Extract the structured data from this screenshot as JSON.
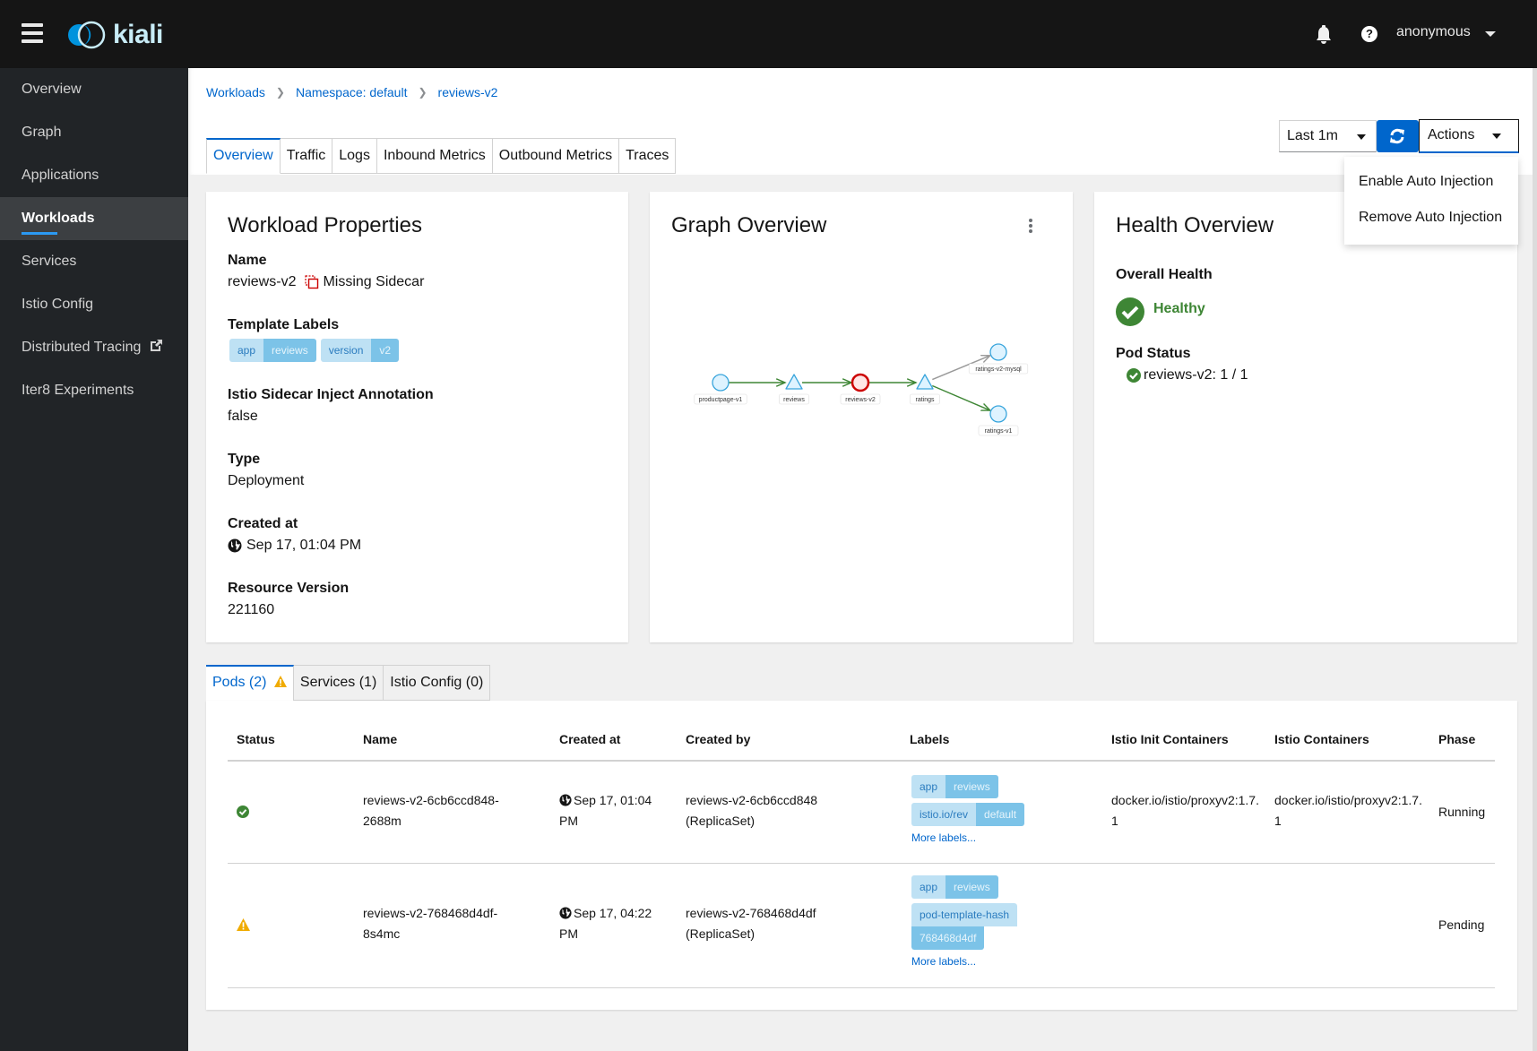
{
  "app": {
    "name": "kiali",
    "logo_icon": "kiali-logo"
  },
  "topbar": {
    "menu_icon": "hamburger-icon",
    "notifications_icon": "bell-icon",
    "help_icon": "question-circle-icon",
    "help_glyph": "?",
    "user": "anonymous"
  },
  "sidebar": {
    "items": [
      {
        "label": "Overview"
      },
      {
        "label": "Graph"
      },
      {
        "label": "Applications"
      },
      {
        "label": "Workloads",
        "active": true
      },
      {
        "label": "Services"
      },
      {
        "label": "Istio Config"
      },
      {
        "label": "Distributed Tracing",
        "icon": "external-link-icon"
      },
      {
        "label": "Iter8 Experiments"
      }
    ]
  },
  "breadcrumb": [
    "Workloads",
    "Namespace: default",
    "reviews-v2"
  ],
  "tabs": [
    {
      "label": "Overview",
      "active": true
    },
    {
      "label": "Traffic"
    },
    {
      "label": "Logs"
    },
    {
      "label": "Inbound Metrics"
    },
    {
      "label": "Outbound Metrics"
    },
    {
      "label": "Traces"
    }
  ],
  "toolbar": {
    "time_range": "Last 1m",
    "refresh_icon": "sync-icon",
    "actions_label": "Actions",
    "actions_menu": [
      "Enable Auto Injection",
      "Remove Auto Injection"
    ]
  },
  "workload_properties": {
    "title": "Workload Properties",
    "name_label": "Name",
    "name": "reviews-v2",
    "missing_sidecar": "Missing Sidecar",
    "template_labels_label": "Template Labels",
    "template_labels": [
      {
        "key": "app",
        "value": "reviews"
      },
      {
        "key": "version",
        "value": "v2"
      }
    ],
    "inject_annotation_label": "Istio Sidecar Inject Annotation",
    "inject_annotation": "false",
    "type_label": "Type",
    "type": "Deployment",
    "created_label": "Created at",
    "created": "Sep 17, 01:04 PM",
    "resource_version_label": "Resource Version",
    "resource_version": "221160"
  },
  "graph_overview": {
    "title": "Graph Overview",
    "nodes": [
      {
        "id": "productpage-v1",
        "shape": "circle",
        "status": "normal"
      },
      {
        "id": "reviews",
        "shape": "triangle",
        "status": "normal"
      },
      {
        "id": "reviews-v2",
        "shape": "circle",
        "status": "error"
      },
      {
        "id": "ratings",
        "shape": "triangle",
        "status": "normal"
      },
      {
        "id": "ratings-v2-mysql",
        "shape": "circle",
        "status": "normal"
      },
      {
        "id": "ratings-v1",
        "shape": "circle",
        "status": "normal"
      }
    ],
    "edges": [
      {
        "from": "productpage-v1",
        "to": "reviews",
        "status": "healthy"
      },
      {
        "from": "reviews",
        "to": "reviews-v2",
        "status": "healthy"
      },
      {
        "from": "reviews-v2",
        "to": "ratings",
        "status": "healthy"
      },
      {
        "from": "ratings",
        "to": "ratings-v2-mysql",
        "status": "idle"
      },
      {
        "from": "ratings",
        "to": "ratings-v1",
        "status": "healthy"
      }
    ],
    "colors": {
      "healthy": "#3e8635",
      "idle": "#999999",
      "node_fill": "#def3ff",
      "node_stroke": "#39a5dc",
      "error_fill": "#ffe6e6",
      "error_stroke": "#cc0000"
    }
  },
  "health_overview": {
    "title": "Health Overview",
    "overall_label": "Overall Health",
    "overall": "Healthy",
    "pod_status_label": "Pod Status",
    "pod_status": "reviews-v2: 1 / 1"
  },
  "bottom_tabs": [
    {
      "label": "Pods (2)",
      "active": true,
      "warning": true
    },
    {
      "label": "Services (1)"
    },
    {
      "label": "Istio Config (0)"
    }
  ],
  "pods_table": {
    "columns": [
      "Status",
      "Name",
      "Created at",
      "Created by",
      "Labels",
      "Istio Init Containers",
      "Istio Containers",
      "Phase"
    ],
    "rows": [
      {
        "status": "healthy",
        "name_line1": "reviews-v2-6cb6ccd848-",
        "name_line2": "2688m",
        "created_line1": "Sep 17, 01:04",
        "created_line2": "PM",
        "created_by_line1": "reviews-v2-6cb6ccd848",
        "created_by_line2": "(ReplicaSet)",
        "labels": [
          {
            "key": "app",
            "value": "reviews"
          },
          {
            "key": "istio.io/rev",
            "value": "default"
          }
        ],
        "more_labels": "More labels...",
        "init_line1": "docker.io/istio/proxyv2:1.7.",
        "init_line2": "1",
        "containers_line1": "docker.io/istio/proxyv2:1.7.",
        "containers_line2": "1",
        "phase": "Running"
      },
      {
        "status": "warning",
        "name_line1": "reviews-v2-768468d4df-",
        "name_line2": "8s4mc",
        "created_line1": "Sep 17, 04:22",
        "created_line2": "PM",
        "created_by_line1": "reviews-v2-768468d4df",
        "created_by_line2": "(ReplicaSet)",
        "labels": [
          {
            "key": "app",
            "value": "reviews"
          },
          {
            "key": "pod-template-hash",
            "value": "768468d4df"
          }
        ],
        "more_labels": "More labels...",
        "phase": "Pending"
      }
    ]
  }
}
